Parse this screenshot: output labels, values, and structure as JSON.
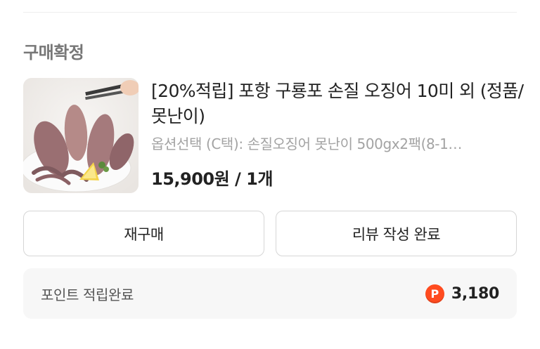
{
  "section": {
    "title": "구매확정"
  },
  "product": {
    "image_alt": "오징어 상품 이미지",
    "name": "[20%적립] 포항 구룡포 손질 오징어 10미 외 (정품/못난이)",
    "option": "옵션선택 (C택): 손질오징어 못난이 500gx2팩(8-1…",
    "price_qty": "15,900원 / 1개"
  },
  "actions": {
    "rebuy_label": "재구매",
    "review_label": "리뷰 작성 완료"
  },
  "points": {
    "label": "포인트 적립완료",
    "icon_letter": "P",
    "value": "3,180",
    "icon_color": "#ff4b1f"
  }
}
